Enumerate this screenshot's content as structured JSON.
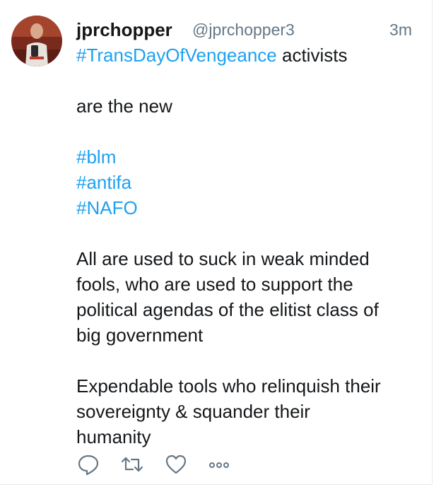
{
  "tweet": {
    "display_name": "jprchopper",
    "handle": "@jprchopper3",
    "time": "3m",
    "lines": [
      {
        "segments": [
          {
            "text": "#TransDayOfVengeance",
            "hashtag": true
          },
          {
            "text": " activists",
            "hashtag": false
          }
        ]
      },
      {
        "segments": [
          {
            "text": "",
            "hashtag": false
          }
        ]
      },
      {
        "segments": [
          {
            "text": "are the new",
            "hashtag": false
          }
        ]
      },
      {
        "segments": [
          {
            "text": "",
            "hashtag": false
          }
        ]
      },
      {
        "segments": [
          {
            "text": "#blm",
            "hashtag": true
          }
        ]
      },
      {
        "segments": [
          {
            "text": "#antifa",
            "hashtag": true
          }
        ]
      },
      {
        "segments": [
          {
            "text": "#NAFO",
            "hashtag": true
          }
        ]
      },
      {
        "segments": [
          {
            "text": "",
            "hashtag": false
          }
        ]
      },
      {
        "segments": [
          {
            "text": "All are used to suck in weak minded",
            "hashtag": false
          }
        ]
      },
      {
        "segments": [
          {
            "text": "fools, who are used to support the",
            "hashtag": false
          }
        ]
      },
      {
        "segments": [
          {
            "text": "political agendas of the elitist class of",
            "hashtag": false
          }
        ]
      },
      {
        "segments": [
          {
            "text": "big government",
            "hashtag": false
          }
        ]
      },
      {
        "segments": [
          {
            "text": "",
            "hashtag": false
          }
        ]
      },
      {
        "segments": [
          {
            "text": "Expendable tools who relinquish their",
            "hashtag": false
          }
        ]
      },
      {
        "segments": [
          {
            "text": "sovereignty & squander their",
            "hashtag": false
          }
        ]
      },
      {
        "segments": [
          {
            "text": "humanity",
            "hashtag": false
          }
        ]
      }
    ],
    "actions": [
      {
        "name": "reply-icon"
      },
      {
        "name": "retweet-icon"
      },
      {
        "name": "like-icon"
      },
      {
        "name": "more-icon"
      }
    ]
  },
  "colors": {
    "hashtag": "#1da1f2",
    "secondary_text": "#657786",
    "icon": "#657786"
  }
}
